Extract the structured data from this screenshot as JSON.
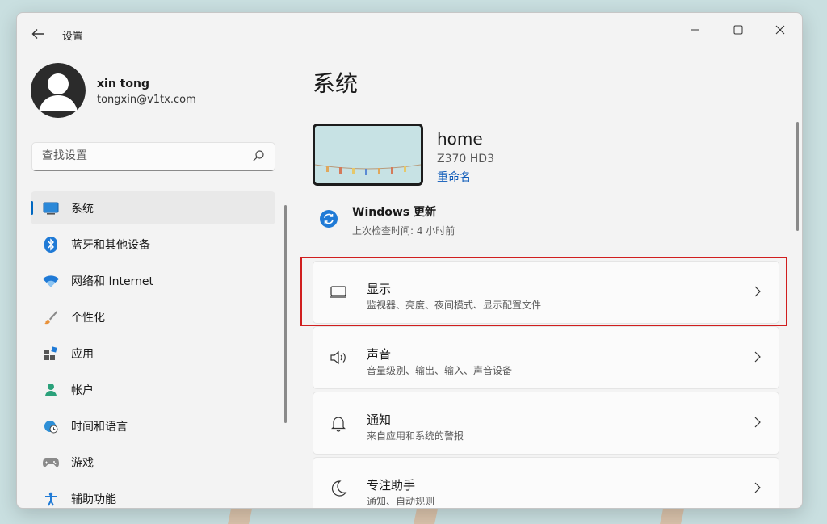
{
  "window": {
    "title": "设置"
  },
  "user": {
    "name": "xin tong",
    "email": "tongxin@v1tx.com"
  },
  "search": {
    "placeholder": "查找设置"
  },
  "nav": {
    "items": [
      {
        "label": "系统",
        "icon": "system-display-icon",
        "selected": true
      },
      {
        "label": "蓝牙和其他设备",
        "icon": "bluetooth-icon"
      },
      {
        "label": "网络和 Internet",
        "icon": "wifi-icon"
      },
      {
        "label": "个性化",
        "icon": "brush-icon"
      },
      {
        "label": "应用",
        "icon": "apps-icon"
      },
      {
        "label": "帐户",
        "icon": "account-icon"
      },
      {
        "label": "时间和语言",
        "icon": "globe-clock-icon"
      },
      {
        "label": "游戏",
        "icon": "gamepad-icon"
      },
      {
        "label": "辅助功能",
        "icon": "accessibility-icon"
      }
    ]
  },
  "main": {
    "title": "系统",
    "device": {
      "name": "home",
      "model": "Z370 HD3",
      "rename_label": "重命名"
    },
    "update": {
      "title": "Windows 更新",
      "subtitle": "上次检查时间: 4 小时前"
    },
    "cards": [
      {
        "title": "显示",
        "subtitle": "监视器、亮度、夜间模式、显示配置文件",
        "icon": "monitor-icon",
        "highlighted": true
      },
      {
        "title": "声音",
        "subtitle": "音量级别、输出、输入、声音设备",
        "icon": "speaker-icon"
      },
      {
        "title": "通知",
        "subtitle": "来自应用和系统的警报",
        "icon": "bell-icon"
      },
      {
        "title": "专注助手",
        "subtitle": "通知、自动规则",
        "icon": "moon-icon"
      }
    ]
  },
  "colors": {
    "accent": "#0067c0",
    "link": "#0a58b8",
    "highlight_border": "#d01e1e",
    "window_bg": "#f3f3f3"
  }
}
